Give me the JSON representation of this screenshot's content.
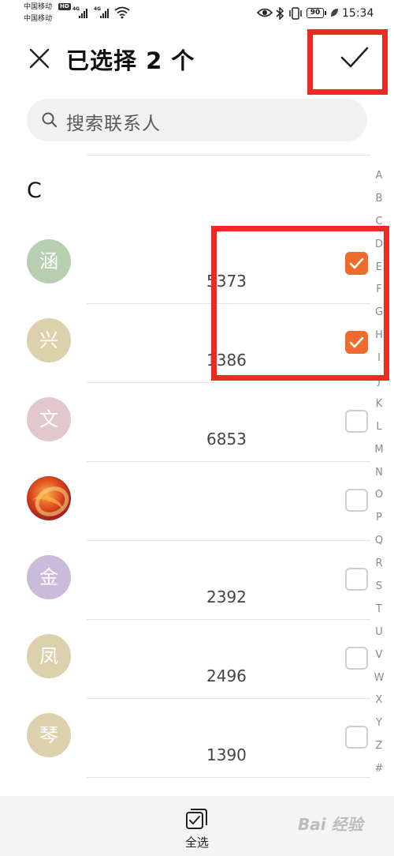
{
  "status_bar": {
    "carrier_1": "中国移动",
    "carrier_2": "中国移动",
    "hd": "HD",
    "signal_1": "4G",
    "signal_2": "4G",
    "battery": "90",
    "time": "15:34"
  },
  "header": {
    "title": "已选择 2 个",
    "close_icon": "close-icon",
    "confirm_icon": "checkmark-icon"
  },
  "search": {
    "placeholder": "搜索联系人",
    "icon": "search-icon"
  },
  "section_letter": "C",
  "contacts": [
    {
      "avatar_text": "涵",
      "avatar_color": "#b6cfb0",
      "phone": "5373",
      "checked": true
    },
    {
      "avatar_text": "兴",
      "avatar_color": "#ddd0ad",
      "phone": "1386",
      "checked": true
    },
    {
      "avatar_text": "文",
      "avatar_color": "#e2c7cd",
      "phone": "6853",
      "checked": false
    },
    {
      "avatar_text": "",
      "avatar_color": "#d2451f",
      "phone": "",
      "checked": false
    },
    {
      "avatar_text": "金",
      "avatar_color": "#c9bbd9",
      "phone": "2392",
      "checked": false
    },
    {
      "avatar_text": "凤",
      "avatar_color": "#ddd0ad",
      "phone": "2496",
      "checked": false
    },
    {
      "avatar_text": "琴",
      "avatar_color": "#ddd0ad",
      "phone": "1390",
      "checked": false
    }
  ],
  "index_letters": [
    "A",
    "B",
    "C",
    "D",
    "E",
    "F",
    "G",
    "H",
    "I",
    "J",
    "K",
    "L",
    "M",
    "N",
    "O",
    "P",
    "Q",
    "R",
    "S",
    "T",
    "U",
    "V",
    "W",
    "X",
    "Y",
    "Z",
    "#"
  ],
  "bottom": {
    "select_all_label": "全选"
  },
  "colors": {
    "accent": "#ee6b2e",
    "highlight": "#ec2a1f"
  },
  "watermark": "Bai 经验"
}
